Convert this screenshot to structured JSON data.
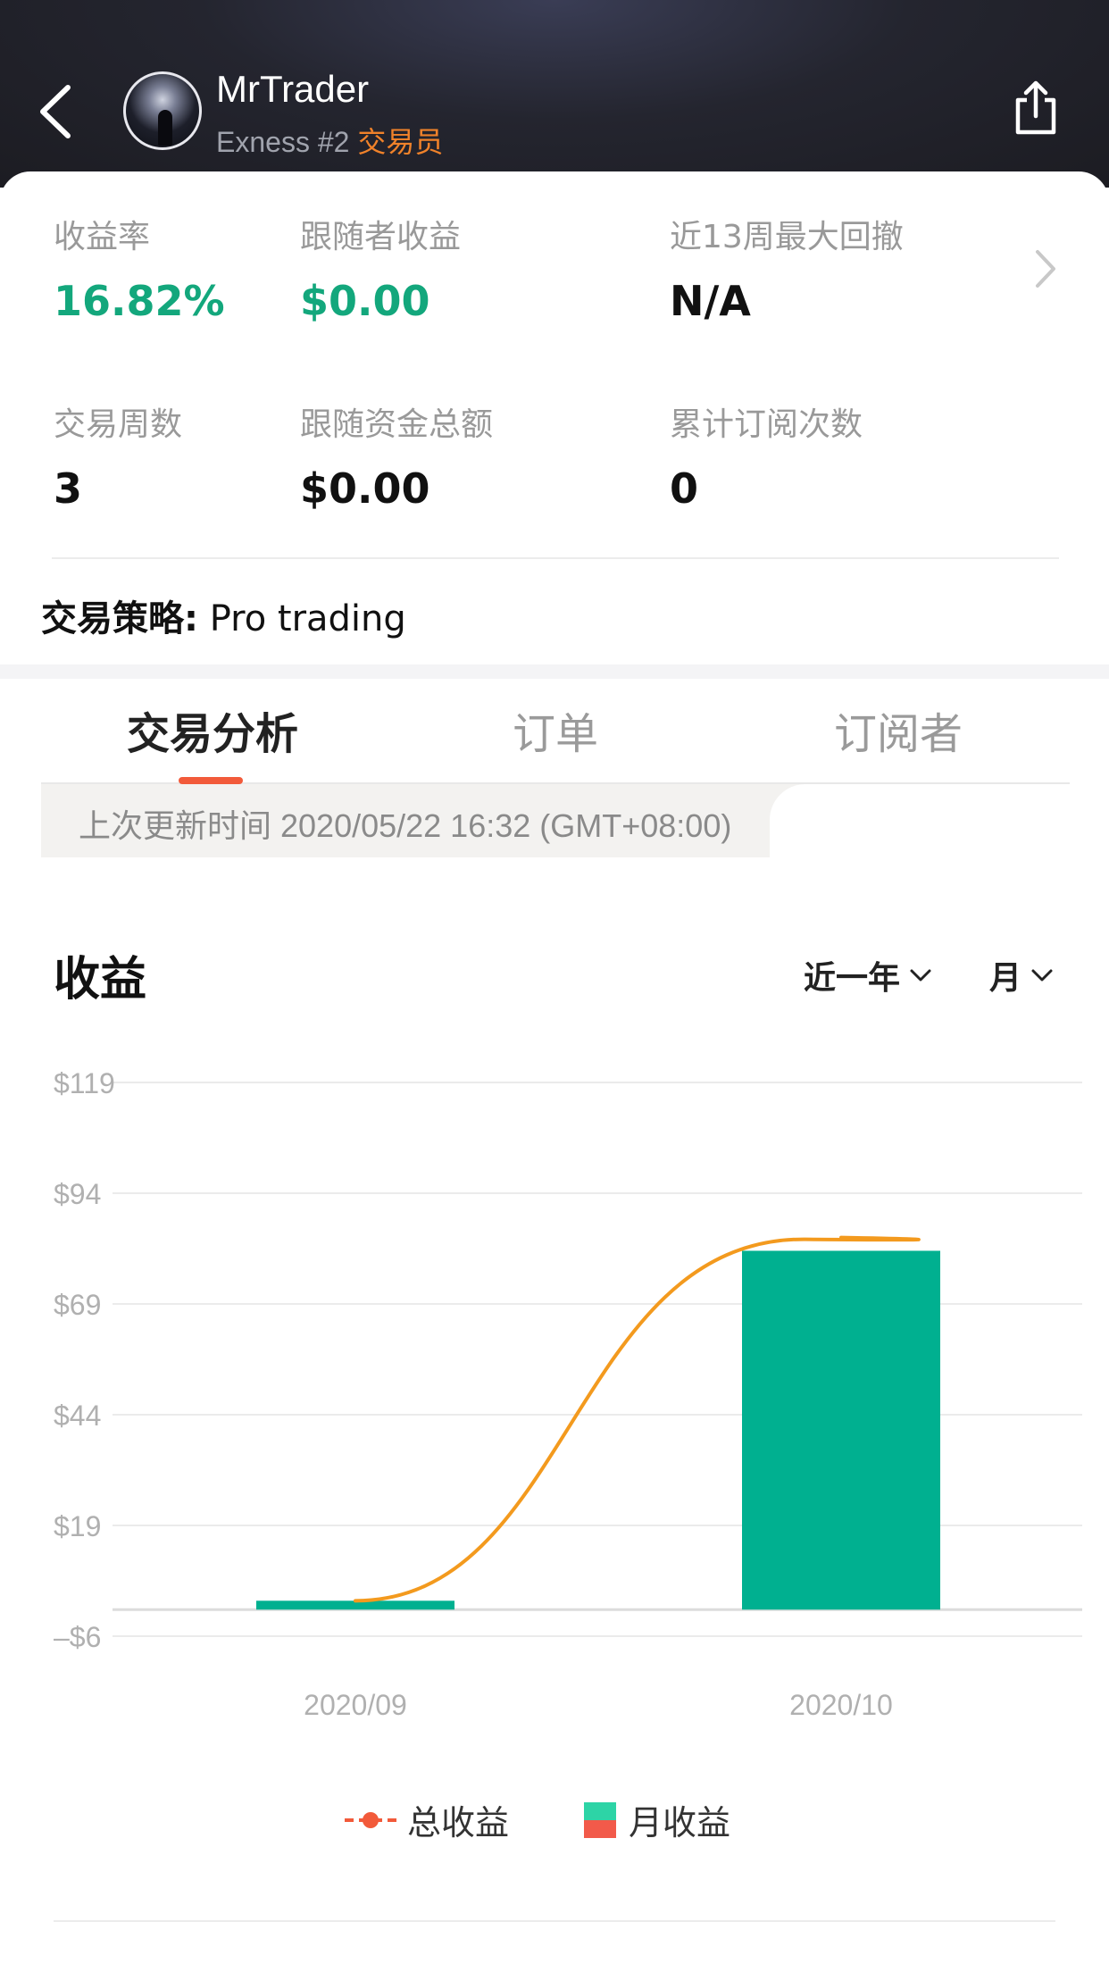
{
  "header": {
    "name": "MrTrader",
    "broker": "Exness #2",
    "role": "交易员"
  },
  "stats": {
    "return_rate_label": "收益率",
    "return_rate_value": "16.82%",
    "follower_profit_label": "跟随者收益",
    "follower_profit_value": "$0.00",
    "max_drawdown_label": "近13周最大回撤",
    "max_drawdown_value": "N/A",
    "trading_weeks_label": "交易周数",
    "trading_weeks_value": "3",
    "follow_funds_label": "跟随资金总额",
    "follow_funds_value": "$0.00",
    "subscriptions_label": "累计订阅次数",
    "subscriptions_value": "0"
  },
  "strategy": {
    "label": "交易策略:",
    "value": "Pro trading"
  },
  "tabs": [
    {
      "label": "交易分析",
      "active": true
    },
    {
      "label": "订单",
      "active": false
    },
    {
      "label": "订阅者",
      "active": false
    }
  ],
  "update": {
    "text": "上次更新时间 2020/05/22 16:32 (GMT+08:00)"
  },
  "earnings": {
    "title": "收益",
    "range_select": "近一年",
    "period_select": "月"
  },
  "colors": {
    "accent_green": "#13a77c",
    "bar_green": "#00b090",
    "line_orange": "#f39a1e",
    "tab_underline": "#f25a3a",
    "role_orange": "#f0822a"
  },
  "chart_data": {
    "type": "bar",
    "categories": [
      "2020/09",
      "2020/10"
    ],
    "series": [
      {
        "name": "月收益",
        "type": "bar",
        "values": [
          2.0,
          81.0
        ]
      },
      {
        "name": "总收益",
        "type": "line",
        "values": [
          2.0,
          84.0
        ]
      }
    ],
    "y_ticks": [
      "$119",
      "$94",
      "$69",
      "$44",
      "$19",
      "–$6"
    ],
    "y_tick_values": [
      119,
      94,
      69,
      44,
      19,
      -6
    ],
    "ylim": [
      -6,
      119
    ],
    "grid": true,
    "legend_position": "bottom-center"
  }
}
